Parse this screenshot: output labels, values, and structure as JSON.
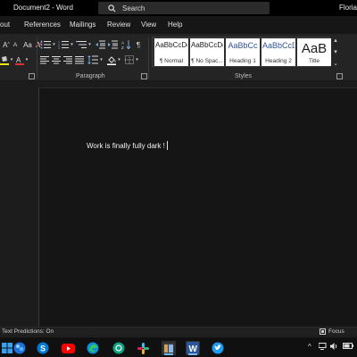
{
  "titlebar": {
    "document_title": "Document2 - Word",
    "search_placeholder": "Search",
    "user_name": "Florian"
  },
  "tabs": [
    {
      "label": "out"
    },
    {
      "label": "References"
    },
    {
      "label": "Mailings"
    },
    {
      "label": "Review"
    },
    {
      "label": "View"
    },
    {
      "label": "Help"
    }
  ],
  "ribbon": {
    "groups": {
      "paragraph": "Paragraph",
      "styles": "Styles"
    },
    "font_grow_label": "A",
    "font_shrink_label": "A",
    "aa_label": "Aa",
    "pilcrow": "¶",
    "styles": [
      {
        "preview": "AaBbCcDc",
        "name": "¶ Normal"
      },
      {
        "preview": "AaBbCcDc",
        "name": "¶ No Spac..."
      },
      {
        "preview": "AaBbCc",
        "name": "Heading 1"
      },
      {
        "preview": "AaBbCcD",
        "name": "Heading 2"
      },
      {
        "preview": "AaB",
        "name": "Title"
      }
    ]
  },
  "document": {
    "body_text": "Work is finally fully dark !"
  },
  "statusbar": {
    "text_predictions": "Text Predictions: On",
    "focus_label": "Focus"
  },
  "colors": {
    "accent": "#2b579a",
    "taskbar_underline": "#76b9ed",
    "heading_blue": "#2f5597"
  }
}
